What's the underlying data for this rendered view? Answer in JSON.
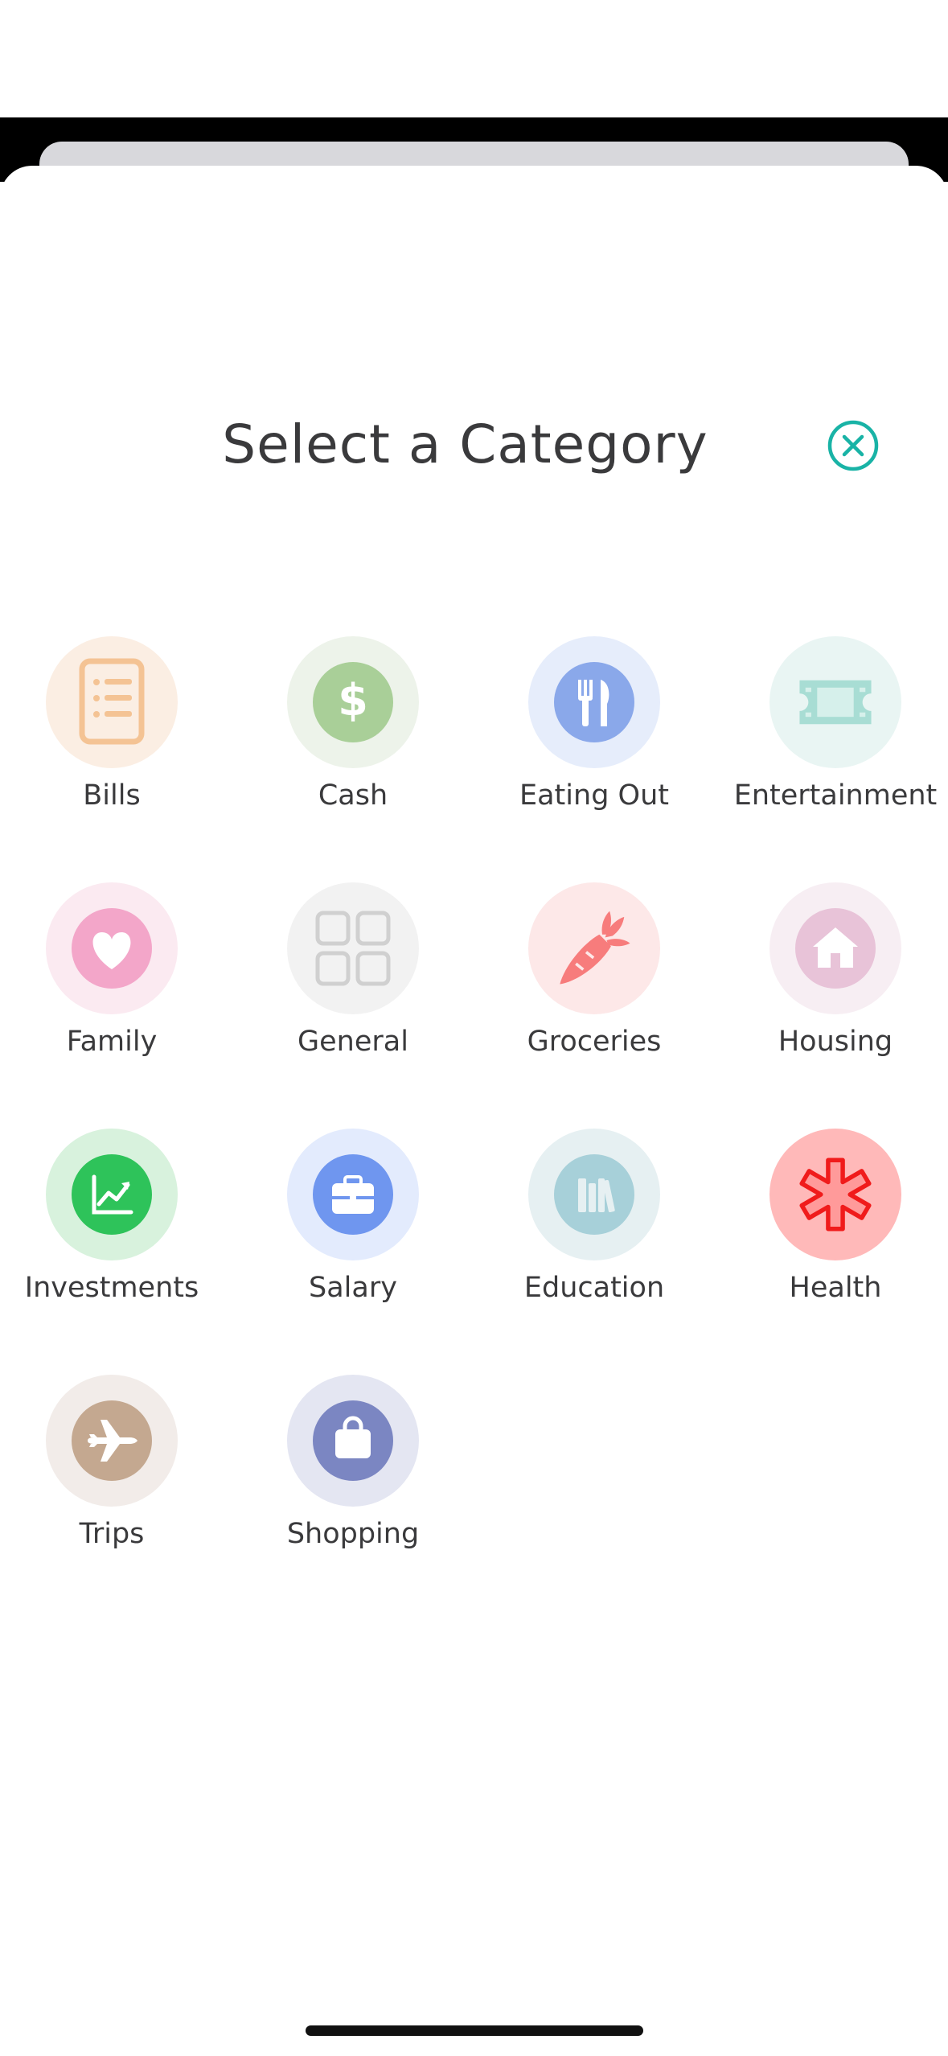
{
  "sheet": {
    "title": "Select a Category",
    "close_icon": "close-circle-icon",
    "accent_color": "#19b3a6"
  },
  "categories": [
    {
      "label": "Bills",
      "icon": "bills-document-icon",
      "ring": "#fbeee3",
      "fill": "#f4c394"
    },
    {
      "label": "Cash",
      "icon": "dollar-icon",
      "ring": "#edf3ea",
      "fill": "#a9cf98"
    },
    {
      "label": "Eating Out",
      "icon": "fork-knife-icon",
      "ring": "#e6edfb",
      "fill": "#8aa8ea"
    },
    {
      "label": "Entertainment",
      "icon": "ticket-film-icon",
      "ring": "#e9f5f3",
      "fill": "#a8ddd4"
    },
    {
      "label": "Family",
      "icon": "heart-icon",
      "ring": "#fbeaf1",
      "fill": "#f3a6c9"
    },
    {
      "label": "General",
      "icon": "grid-icon",
      "ring": "#f2f2f2",
      "fill": "#d0d0d0"
    },
    {
      "label": "Groceries",
      "icon": "carrot-icon",
      "ring": "#fde8e8",
      "fill": "#f77c7c"
    },
    {
      "label": "Housing",
      "icon": "house-icon",
      "ring": "#f7eef3",
      "fill": "#e8c3d8"
    },
    {
      "label": "Investments",
      "icon": "chart-up-icon",
      "ring": "#d8f2dd",
      "fill": "#2ec35a"
    },
    {
      "label": "Salary",
      "icon": "briefcase-icon",
      "ring": "#e3ebfd",
      "fill": "#6f96ef"
    },
    {
      "label": "Education",
      "icon": "books-icon",
      "ring": "#e6f0f2",
      "fill": "#a7d0d9"
    },
    {
      "label": "Health",
      "icon": "medical-asterisk-icon",
      "ring": "#ffb9b9",
      "fill": "#ff8e8e"
    },
    {
      "label": "Trips",
      "icon": "airplane-icon",
      "ring": "#f2ece9",
      "fill": "#c4a890"
    },
    {
      "label": "Shopping",
      "icon": "shopping-bag-icon",
      "ring": "#e4e6f2",
      "fill": "#7b86c2"
    }
  ]
}
